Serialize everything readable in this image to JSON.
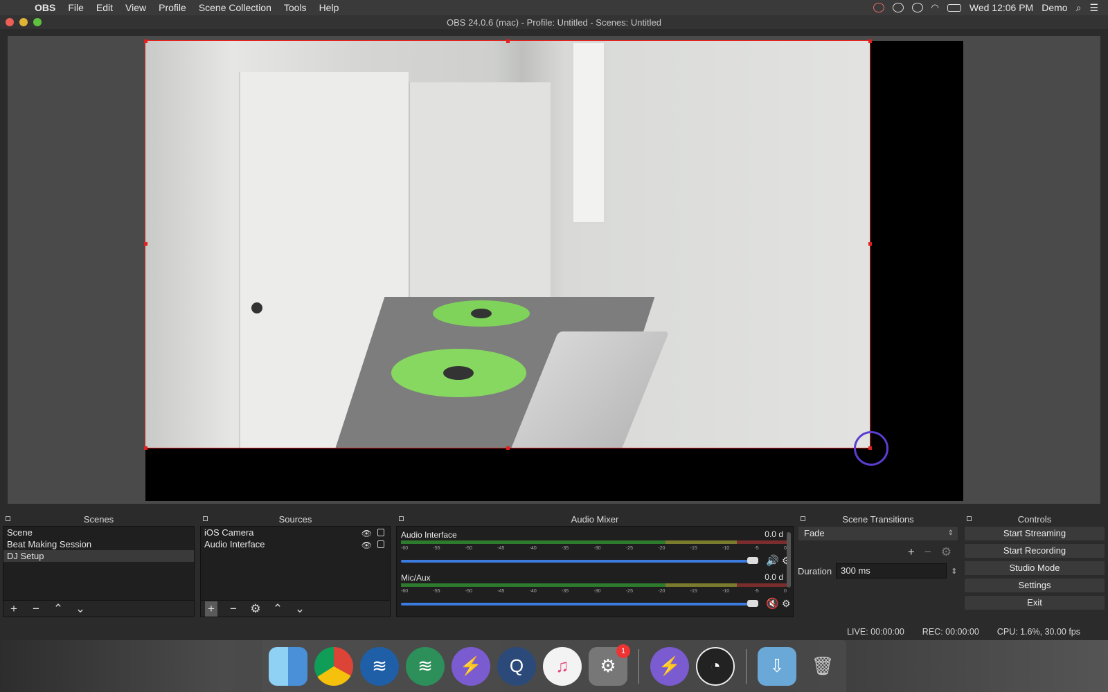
{
  "menubar": {
    "app_name": "OBS",
    "items": [
      "File",
      "Edit",
      "View",
      "Profile",
      "Scene Collection",
      "Tools",
      "Help"
    ],
    "clock": "Wed 12:06 PM",
    "user": "Demo"
  },
  "window": {
    "title": "OBS 24.0.6 (mac) - Profile: Untitled - Scenes: Untitled"
  },
  "scenes": {
    "title": "Scenes",
    "items": [
      "Scene",
      "Beat Making Session",
      "DJ Setup"
    ],
    "selected": "DJ Setup"
  },
  "sources": {
    "title": "Sources",
    "items": [
      "iOS Camera",
      "Audio Interface"
    ]
  },
  "mixer": {
    "title": "Audio Mixer",
    "channels": [
      {
        "name": "Audio Interface",
        "db": "0.0 d",
        "muted": false
      },
      {
        "name": "Mic/Aux",
        "db": "0.0 d",
        "muted": true
      }
    ],
    "ticks": [
      "-60",
      "-55",
      "-50",
      "-45",
      "-40",
      "-35",
      "-30",
      "-25",
      "-20",
      "-15",
      "-10",
      "-5",
      "0"
    ]
  },
  "transitions": {
    "title": "Scene Transitions",
    "selected": "Fade",
    "duration_label": "Duration",
    "duration_value": "300 ms"
  },
  "controls": {
    "title": "Controls",
    "buttons": [
      "Start Streaming",
      "Start Recording",
      "Studio Mode",
      "Settings",
      "Exit"
    ]
  },
  "status": {
    "live": "LIVE: 00:00:00",
    "rec": "REC: 00:00:00",
    "cpu": "CPU: 1.6%, 30.00 fps"
  },
  "dock": {
    "badge": "1"
  }
}
